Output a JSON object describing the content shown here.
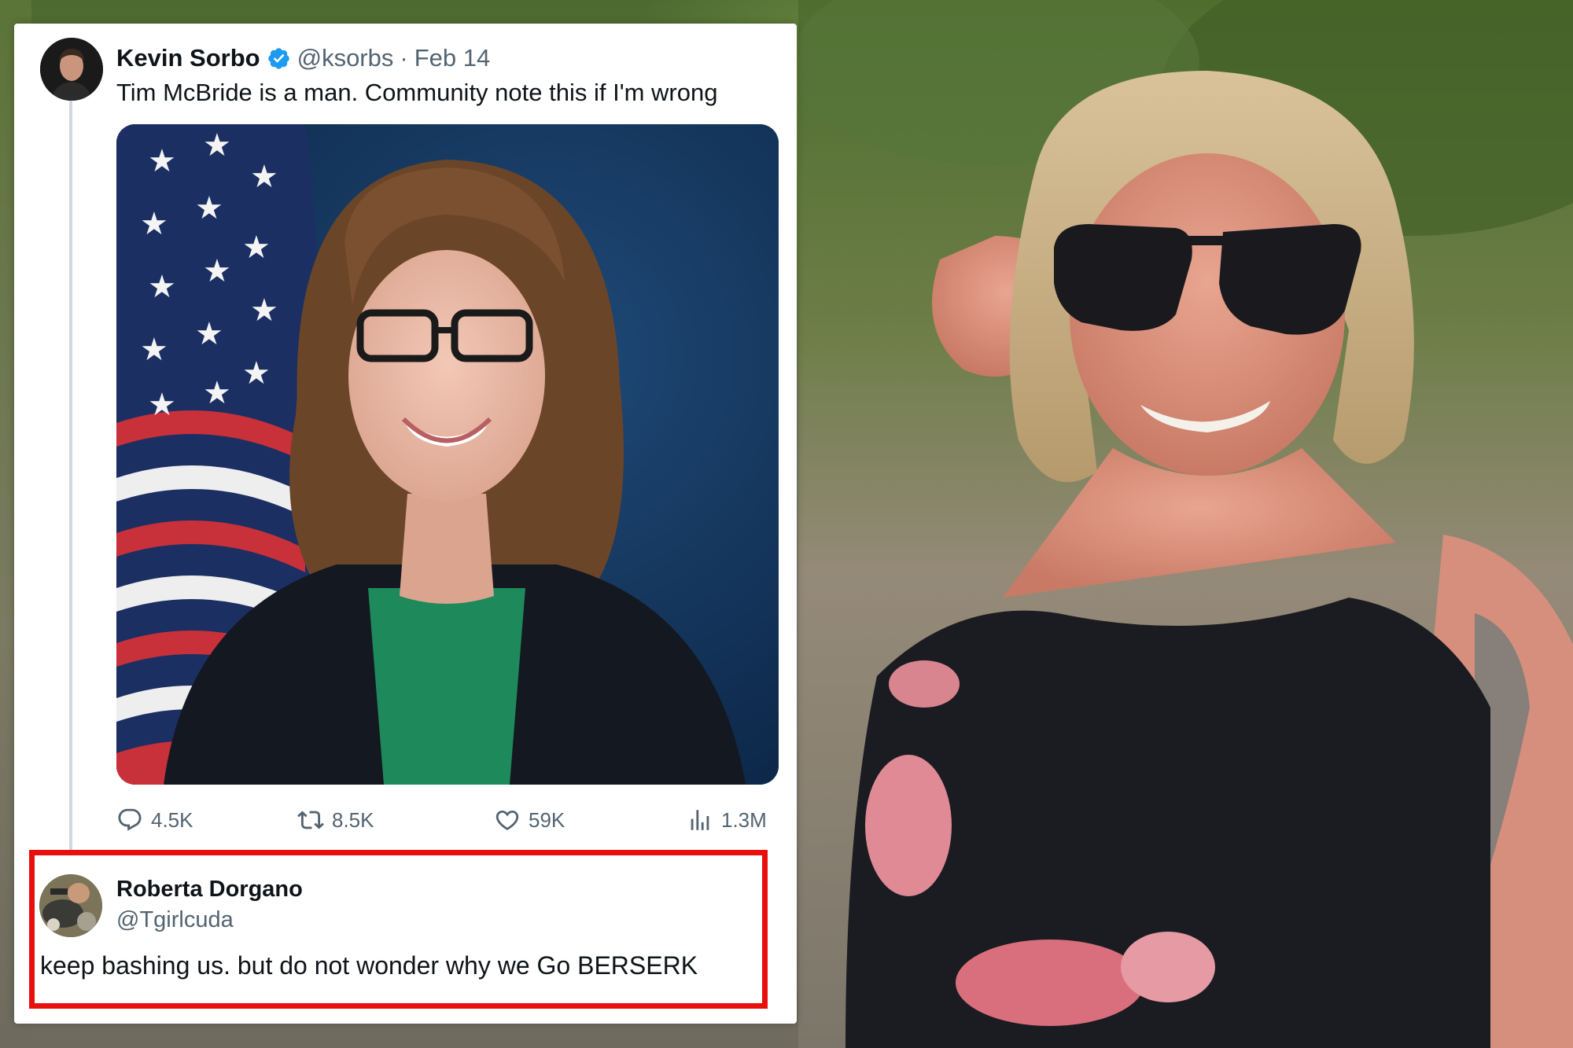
{
  "post": {
    "author_name": "Kevin Sorbo",
    "verified": true,
    "handle": "@ksorbs",
    "separator": "·",
    "date": "Feb 14",
    "text": "Tim McBride is a man. Community note this if I'm wrong",
    "metrics": {
      "replies": "4.5K",
      "reposts": "8.5K",
      "likes": "59K",
      "views": "1.3M"
    }
  },
  "reply": {
    "author_name": "Roberta Dorgano",
    "handle": "@Tgirlcuda",
    "text": "keep bashing us. but do not wonder why we Go BERSERK"
  },
  "colors": {
    "verified_badge": "#1d9bf0",
    "highlight_border": "#e8100e",
    "secondary_text": "#536471",
    "primary_text": "#0f1419",
    "thread_line": "#cfd9de"
  },
  "icons": [
    "verified-badge-icon",
    "reply-icon",
    "repost-icon",
    "like-icon",
    "views-icon"
  ]
}
